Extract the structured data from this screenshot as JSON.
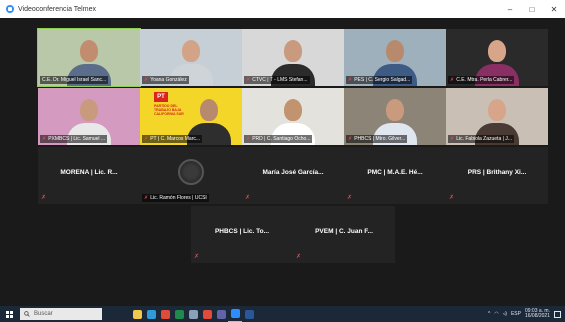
{
  "window": {
    "title": "Videoconferencia Telmex",
    "minimize": "–",
    "maximize": "□",
    "close": "✕"
  },
  "tiles": [
    {
      "id": "t1",
      "name": "C.E. Dr. Miguel Israel Sanc...",
      "muted": false,
      "active": true,
      "bg": "#b9c8a8",
      "skin": "#c28d6f",
      "shirt": "#5a6d8a"
    },
    {
      "id": "t2",
      "name": "Yoana González",
      "muted": true,
      "bg": "#c7cfd6",
      "skin": "#d2a386",
      "shirt": "#cfd4d9"
    },
    {
      "id": "t3",
      "name": "CTVC | T - LMS Stefan...",
      "muted": true,
      "bg": "#d8d8d8",
      "skin": "#c99a7e",
      "shirt": "#2b2b2b"
    },
    {
      "id": "t4",
      "name": "PES | C. Sergio Salgad...",
      "muted": true,
      "bg": "#9fb0bd",
      "skin": "#b88a6d",
      "shirt": "#3e5b86"
    },
    {
      "id": "t5",
      "name": "C.E. Mtra. Perla Cabrer...",
      "muted": true,
      "bg": "#2a2a2a",
      "skin": "#d7a68a",
      "shirt": "#8a2f63"
    },
    {
      "id": "t6",
      "name": "PXMBCS | Lic. Samuel ...",
      "muted": true,
      "bg": "#d59abf",
      "skin": "#c99a7e",
      "shirt": "#e8e8e8"
    },
    {
      "id": "t7",
      "name": "PT | C. Marcos Marc...",
      "muted": true,
      "pt": true,
      "pt_logo": "PT",
      "pt_caption": "PARTIDO DEL TRABAJO BAJA CALIFORNIA SUR",
      "skin": "#b88a6d",
      "shirt": "#2e2e2e"
    },
    {
      "id": "t8",
      "name": "PRD | C. Santiago Ocho...",
      "muted": true,
      "bg": "#e4e2dd",
      "skin": "#c2936f",
      "shirt": "#ffffff"
    },
    {
      "id": "t9",
      "name": "PHBCS | Mtro. Gilver...",
      "muted": true,
      "bg": "#8c8577",
      "skin": "#c99a7e",
      "shirt": "#dfe6ef"
    },
    {
      "id": "t10",
      "name": "Lic. Fabiola Zazueta | J...",
      "muted": true,
      "bg": "#c9bfb5",
      "skin": "#d7a68a",
      "shirt": "#4a3a34"
    },
    {
      "id": "t11",
      "name": "MORENA | Lic. R...",
      "muted": true,
      "camera_off": true
    },
    {
      "id": "t12",
      "name": "Lic. Ramón Flores | UCSI",
      "muted": true,
      "logo": true
    },
    {
      "id": "t13",
      "name": "María José García...",
      "muted": true,
      "camera_off": true
    },
    {
      "id": "t14",
      "name": "PMC | M.A.E. Hé...",
      "muted": true,
      "camera_off": true
    },
    {
      "id": "t15",
      "name": "PRS | Brithany Xi...",
      "muted": true,
      "camera_off": true
    },
    {
      "id": "t16",
      "name": "PHBCS | Lic. To...",
      "muted": true,
      "camera_off": true
    },
    {
      "id": "t17",
      "name": "PVEM | C. Juan F...",
      "muted": true,
      "camera_off": true
    }
  ],
  "taskbar": {
    "search_placeholder": "Buscar",
    "apps": [
      {
        "icon": "file-explorer-icon",
        "color": "#f2c94c"
      },
      {
        "icon": "edge-icon",
        "color": "#2f9bd8"
      },
      {
        "icon": "chrome-icon",
        "color": "#e04b3a"
      },
      {
        "icon": "excel-icon",
        "color": "#1f8a4c"
      },
      {
        "icon": "file-icon",
        "color": "#8aa0b8"
      },
      {
        "icon": "chrome-icon-2",
        "color": "#e04b3a"
      },
      {
        "icon": "teams-icon",
        "color": "#6264a7"
      },
      {
        "icon": "zoom-icon",
        "color": "#2d8cff",
        "active": true
      },
      {
        "icon": "word-icon",
        "color": "#2b579a"
      }
    ],
    "tray_text": "ESP",
    "time": "09:03 a. m.",
    "date": "16/08/2021"
  }
}
